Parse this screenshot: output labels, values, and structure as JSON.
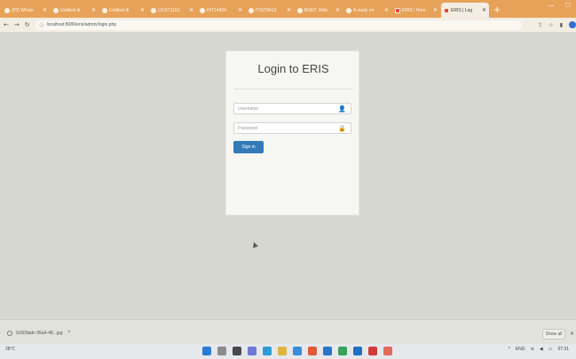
{
  "browser": {
    "tabs": [
      {
        "label": "(20) Whats",
        "active": false,
        "icon": "whatsapp-icon"
      },
      {
        "label": "Untitled di",
        "active": false,
        "icon": "globe-icon"
      },
      {
        "label": "Untitled di",
        "active": false,
        "icon": "globe-icon"
      },
      {
        "label": "UCST1101",
        "active": false,
        "icon": "globe-icon"
      },
      {
        "label": "HIT14424",
        "active": false,
        "icon": "globe-icon"
      },
      {
        "label": "ITIST8412",
        "active": false,
        "icon": "globe-icon"
      },
      {
        "label": "BGET. Web",
        "active": false,
        "icon": "globe-icon"
      },
      {
        "label": "A study on",
        "active": false,
        "icon": "globe-icon"
      },
      {
        "label": "ERIS / Hom",
        "active": false,
        "icon": "app-icon"
      },
      {
        "label": "ERIS | Log",
        "active": true,
        "icon": "app-icon"
      }
    ],
    "new_tab_label": "+",
    "url": "localhost:8080/eris/admin/login.php"
  },
  "login": {
    "title": "Login to ERIS",
    "username_placeholder": "Username",
    "password_placeholder": "Password",
    "signin_label": "Sign in"
  },
  "downloads": {
    "file_name": "0c509adc-95a4-48...jpg",
    "show_all_label": "Show all"
  },
  "taskbar": {
    "weather": "28°C",
    "language": "ENG",
    "time": "07:31"
  },
  "colors": {
    "tabstrip": "#e7a25a",
    "signin_button": "#337ab7"
  }
}
